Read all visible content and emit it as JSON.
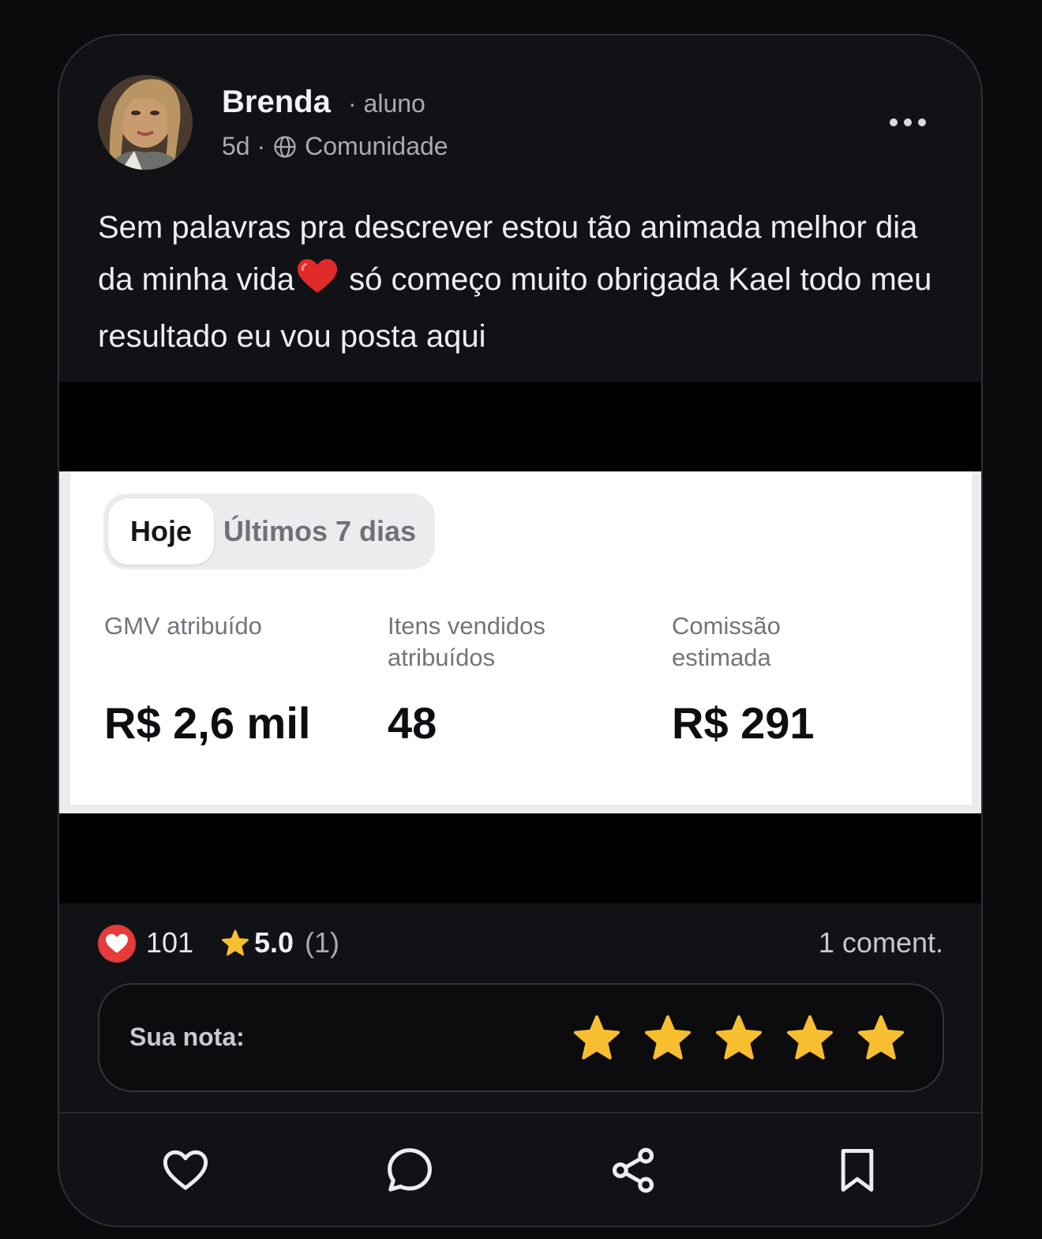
{
  "post": {
    "author": {
      "name": "Brenda",
      "role": "· aluno",
      "avatar_icon": "profile-photo"
    },
    "time": "5d ·",
    "audience_icon": "globe-icon",
    "audience": "Comunidade",
    "more_icon": "ellipsis-icon",
    "text_part1": "Sem palavras pra descrever estou tão animada melhor dia da minha vida",
    "text_emoji": "❤️",
    "text_part2": " só começo muito obrigada Kael todo meu resultado eu vou posta aqui"
  },
  "media": {
    "tabs": [
      {
        "label": "Hoje",
        "active": true
      },
      {
        "label": "Últimos 7 dias",
        "active": false
      }
    ],
    "stats": [
      {
        "label": "GMV atribuído",
        "value": "R$ 2,6 mil"
      },
      {
        "label": "Itens vendidos atribuídos",
        "value": "48"
      },
      {
        "label": "Comissão estimada",
        "value": "R$ 291"
      }
    ]
  },
  "engagement": {
    "likes": "101",
    "rating": "5.0",
    "rating_count": "(1)",
    "comments": "1 coment.",
    "like_color": "#e53b3b",
    "star_color": "#f7be2f"
  },
  "rate": {
    "label": "Sua nota:",
    "stars_filled": 5,
    "stars_total": 5
  },
  "actions": [
    {
      "name": "like",
      "icon": "heart-outline-icon"
    },
    {
      "name": "comment",
      "icon": "speech-bubble-icon"
    },
    {
      "name": "share",
      "icon": "share-icon"
    },
    {
      "name": "save",
      "icon": "bookmark-icon"
    }
  ]
}
